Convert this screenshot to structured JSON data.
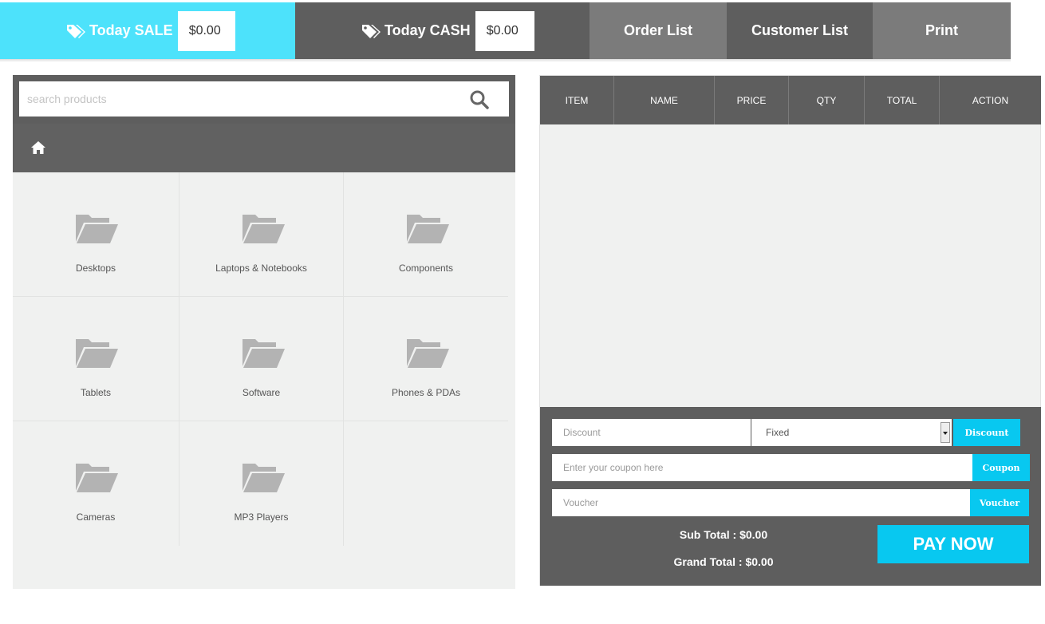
{
  "stats": {
    "sale_label": "Today SALE",
    "sale_value": "$0.00",
    "cash_label": "Today CASH",
    "cash_value": "$0.00"
  },
  "nav": {
    "order_list": "Order List",
    "customer_list": "Customer List",
    "print": "Print"
  },
  "search": {
    "placeholder": "search products"
  },
  "categories": [
    {
      "label": "Desktops"
    },
    {
      "label": "Laptops & Notebooks"
    },
    {
      "label": "Components"
    },
    {
      "label": "Tablets"
    },
    {
      "label": "Software"
    },
    {
      "label": "Phones & PDAs"
    },
    {
      "label": "Cameras"
    },
    {
      "label": "MP3 Players"
    }
  ],
  "cart": {
    "columns": [
      "ITEM",
      "NAME",
      "PRICE",
      "QTY",
      "TOTAL",
      "ACTION"
    ],
    "discount_placeholder": "Discount",
    "discount_type": "Fixed",
    "discount_button": "Discount",
    "coupon_placeholder": "Enter your coupon here",
    "coupon_button": "Coupon",
    "voucher_placeholder": "Voucher",
    "voucher_button": "Voucher",
    "sub_total": "Sub Total : $0.00",
    "grand_total": "Grand Total : $0.00",
    "pay_button": "PAY NOW"
  },
  "colors": {
    "accent": "#08c8f0",
    "sale_bg": "#4de2fb",
    "dark_bg": "#5e5e5e",
    "mid_bg": "#7b7b7b",
    "panel_bg": "#f0f1f0"
  }
}
